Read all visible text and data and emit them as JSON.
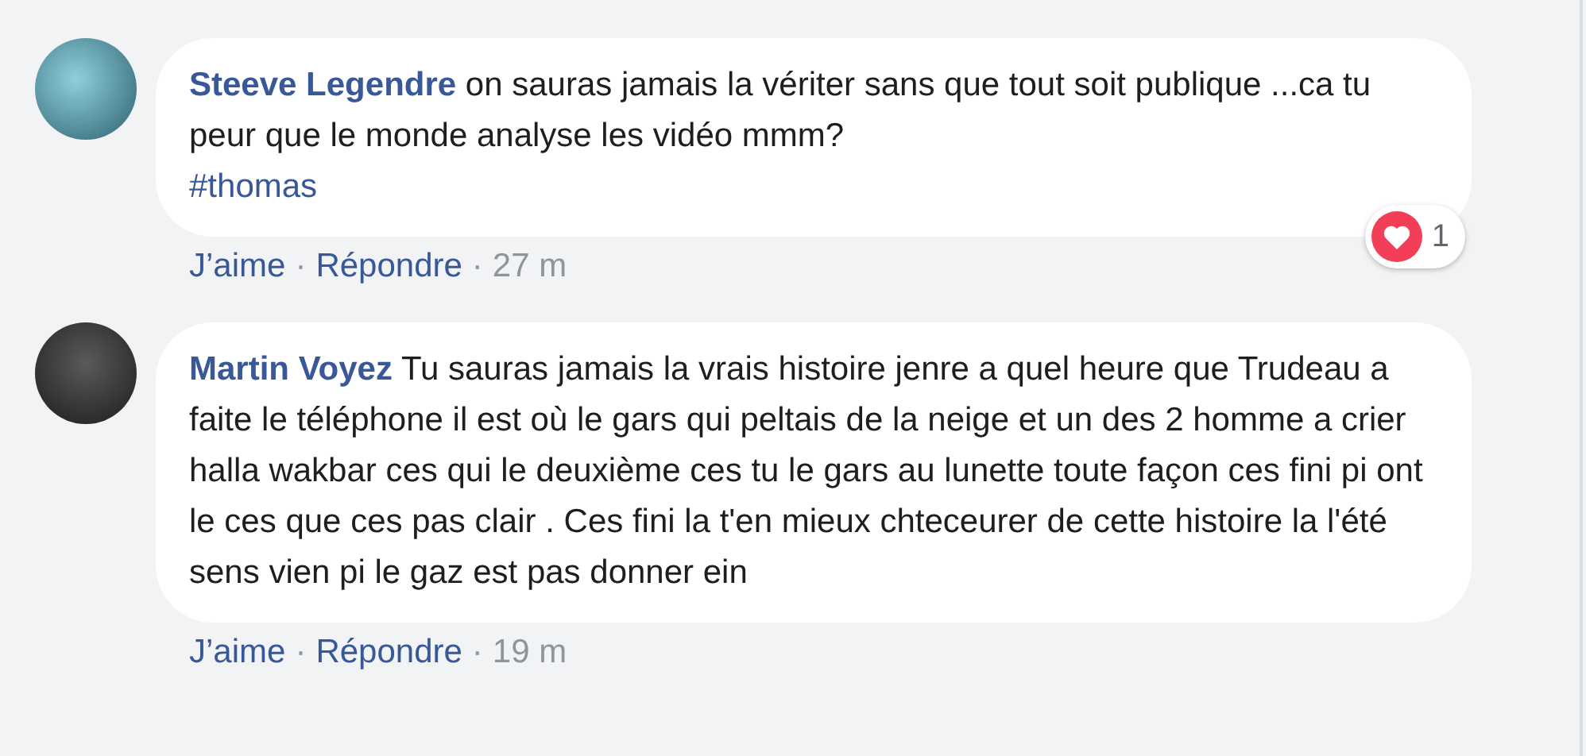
{
  "comments": [
    {
      "author": "Steeve Legendre",
      "text": "on sauras jamais la vériter sans que tout soit publique ...ca tu peur que le monde analyse les vidéo mmm?",
      "hashtag": "#thomas",
      "actions": [
        "J’aime",
        "Répondre"
      ],
      "separator": "·",
      "time": "27 m",
      "reaction": {
        "kind": "love",
        "count": "1"
      }
    },
    {
      "author": "Martin Voyez",
      "text": "Tu sauras jamais la vrais histoire jenre a quel heure que Trudeau a faite le téléphone il est où le gars qui peltais de la neige et un des 2 homme a crier halla wakbar ces qui le deuxième ces tu le gars au lunette toute façon ces fini pi ont le ces que ces pas clair . Ces fini la t'en mieux chteceurer de cette histoire la l'été sens vien pi le gaz est pas donner ein",
      "actions": [
        "J’aime",
        "Répondre"
      ],
      "separator": "·",
      "time": "19 m"
    }
  ]
}
